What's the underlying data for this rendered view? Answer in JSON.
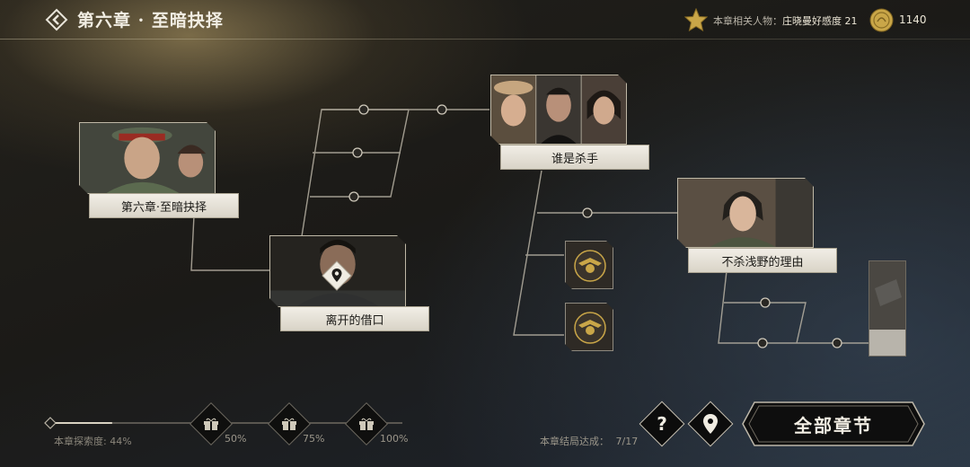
{
  "header": {
    "chapter_title": "第六章 · 至暗抉择",
    "affinity_prefix": "本章相关人物：",
    "affinity_text": "庄晓曼好感度 21",
    "coin_count": "1140",
    "icons": [
      "back-icon",
      "star-icon",
      "coin-icon"
    ]
  },
  "story_nodes": [
    {
      "label": "第六章·至暗抉择"
    },
    {
      "label": "离开的借口",
      "current": true
    },
    {
      "label": "谁是杀手"
    },
    {
      "label": "不杀浅野的理由"
    }
  ],
  "locked_nodes": [
    "emblem-icon",
    "emblem-icon"
  ],
  "progress": {
    "label": "本章探索度:",
    "value": "44%",
    "fraction": 0.44,
    "milestones": [
      "50%",
      "75%",
      "100%"
    ]
  },
  "endings": {
    "label": "本章结局达成：",
    "value": "7/17"
  },
  "buttons": {
    "help_label": "?",
    "all_chapters_label": "全部章节"
  },
  "colors": {
    "label_plate": "#eae6dc",
    "line": "#b8b2a4",
    "gold": "#c9a648"
  }
}
